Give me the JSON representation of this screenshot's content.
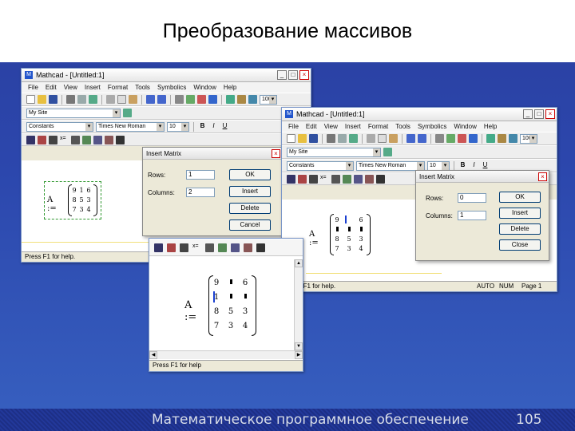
{
  "slide": {
    "title": "Преобразование массивов",
    "footer": "Математическое программное обеспечение",
    "page_number": "105"
  },
  "win1": {
    "title": "Mathcad - [Untitled:1]",
    "menu": [
      "File",
      "Edit",
      "View",
      "Insert",
      "Format",
      "Tools",
      "Symbolics",
      "Window",
      "Help"
    ],
    "zoom": "100",
    "style_combo": "My Site",
    "font_style": "Constants",
    "font_name": "Times New Roman",
    "font_size": "10",
    "matrix_label": "A :=",
    "matrix": [
      [
        "9",
        "1",
        "6"
      ],
      [
        "8",
        "5",
        "3"
      ],
      [
        "7",
        "3",
        "4"
      ]
    ],
    "status": "Press F1 for help."
  },
  "dialog1": {
    "title": "Insert Matrix",
    "rows_label": "Rows:",
    "rows_value": "1",
    "columns_label": "Columns:",
    "columns_value": "2",
    "ok": "OK",
    "insert": "Insert",
    "delete": "Delete",
    "cancel": "Cancel"
  },
  "win2": {
    "title": "Mathcad - [Untitled:1]",
    "menu": [
      "File",
      "Edit",
      "View",
      "Insert",
      "Format",
      "Tools",
      "Symbolics",
      "Window",
      "Help"
    ],
    "zoom": "100",
    "style_combo": "My Site",
    "font_style": "Constants",
    "font_name": "Times New Roman",
    "font_size": "10",
    "matrix_label": "A :=",
    "matrix": [
      [
        "9",
        "",
        "6"
      ],
      [
        "8",
        "5",
        "3"
      ],
      [
        "7",
        "3",
        "4"
      ]
    ],
    "status": "Press F1 for help.",
    "status_auto": "AUTO",
    "status_num": "NUM",
    "status_page": "Page 1"
  },
  "dialog2": {
    "title": "Insert Matrix",
    "rows_label": "Rows:",
    "rows_value": "0",
    "columns_label": "Columns:",
    "columns_value": "1",
    "ok": "OK",
    "insert": "Insert",
    "delete": "Delete",
    "close": "Close"
  },
  "win3": {
    "matrix_label": "A :=",
    "matrix": [
      [
        "9",
        "",
        "6"
      ],
      [
        "1",
        "",
        ""
      ],
      [
        "8",
        "5",
        "3"
      ],
      [
        "7",
        "3",
        "4"
      ]
    ],
    "status": "Press F1 for help"
  }
}
